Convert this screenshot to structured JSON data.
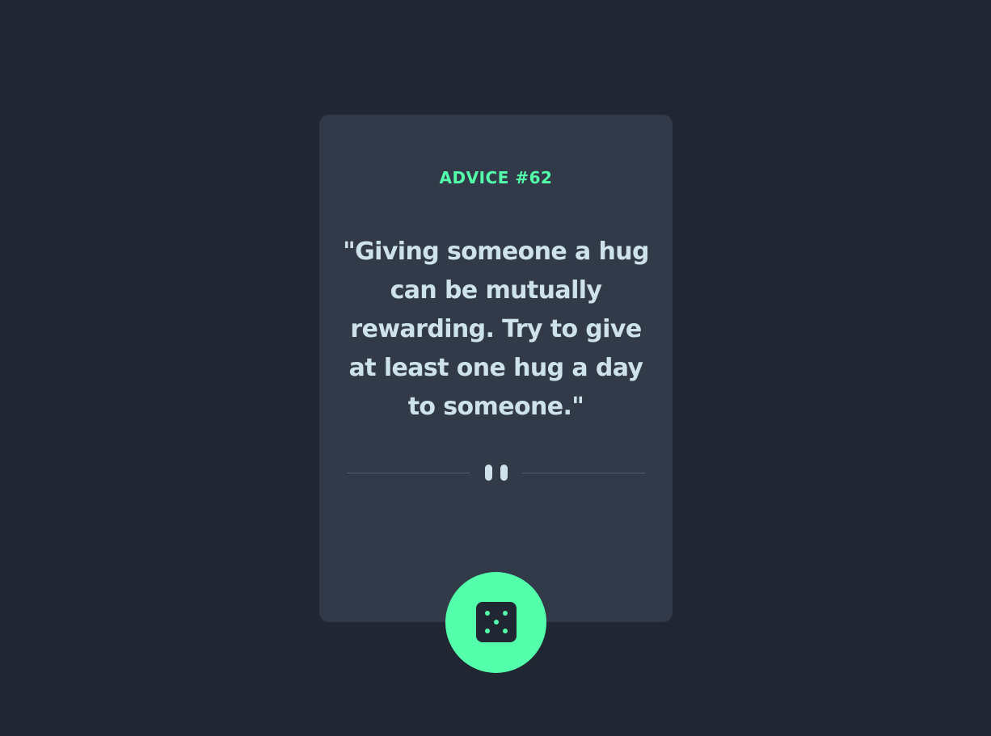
{
  "advice": {
    "label": "ADVICE #62",
    "quote": "\"Giving someone a hug can be mutually rewarding. Try to give at least one hug a day to someone.\""
  },
  "divider": {
    "icon": "pause-icon"
  },
  "button": {
    "icon": "dice-icon"
  },
  "colors": {
    "background": "#202632",
    "card": "#323a49",
    "accent": "#53ffaa",
    "text": "#cee3e9",
    "divider": "#4f5d74"
  }
}
